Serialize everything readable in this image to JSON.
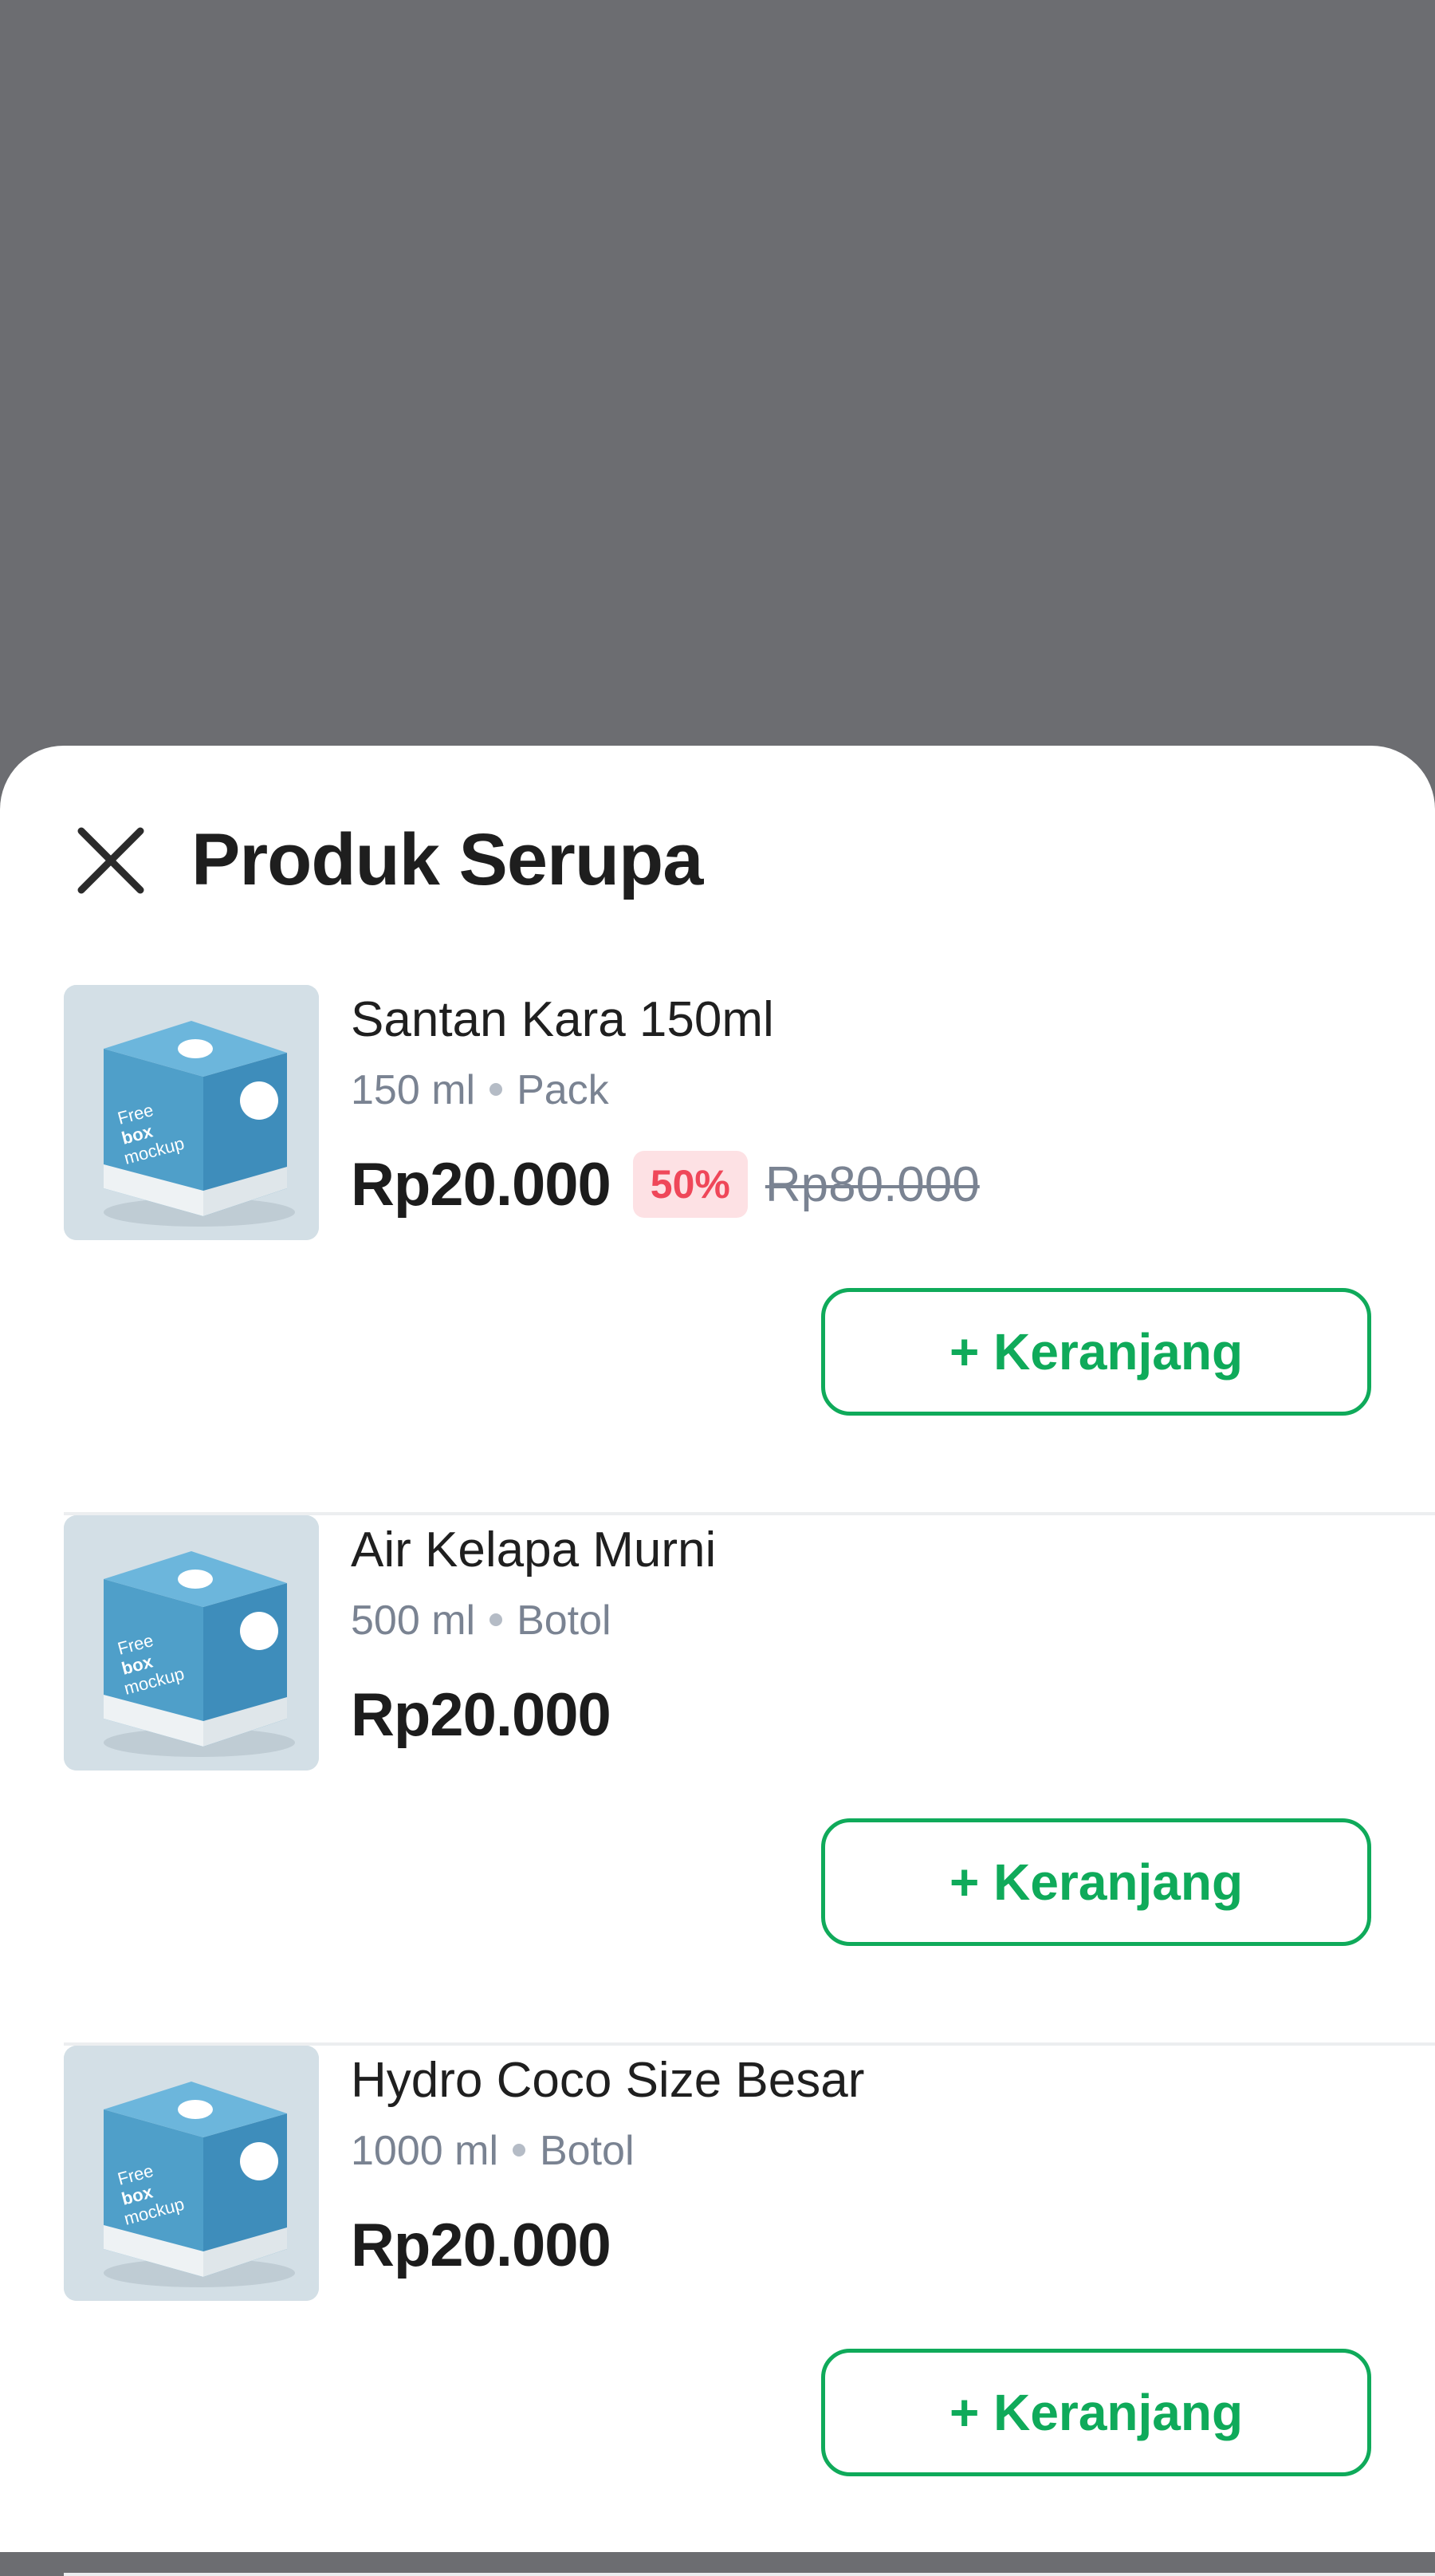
{
  "sheet": {
    "title": "Produk Serupa",
    "close_icon": "close-icon"
  },
  "colors": {
    "overlay": "#6c6d71",
    "accent_green": "#0faa5a",
    "discount_red": "#ef4759",
    "discount_bg": "#fde1e4",
    "muted_text": "#7a8392"
  },
  "products": [
    {
      "name": "Santan Kara 150ml",
      "size": "150 ml",
      "unit": "Pack",
      "price": "Rp20.000",
      "discount": "50%",
      "old_price": "Rp80.000",
      "cart_label": "+ Keranjang"
    },
    {
      "name": "Air Kelapa Murni",
      "size": "500 ml",
      "unit": "Botol",
      "price": "Rp20.000",
      "cart_label": "+ Keranjang"
    },
    {
      "name": "Hydro Coco Size Besar",
      "size": "1000 ml",
      "unit": "Botol",
      "price": "Rp20.000",
      "cart_label": "+ Keranjang"
    }
  ],
  "thumbnail": {
    "box_text_1": "Free",
    "box_text_2": "box",
    "box_text_3": "mockup"
  }
}
